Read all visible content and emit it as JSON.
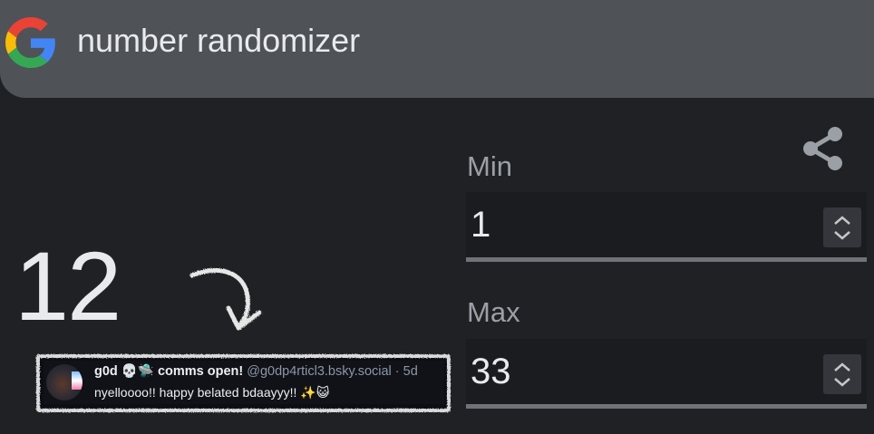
{
  "search": {
    "query": "number randomizer",
    "logo_icon": "google-g-logo"
  },
  "randomizer": {
    "result": "12",
    "share_icon": "share-icon",
    "min": {
      "label": "Min",
      "value": "1"
    },
    "max": {
      "label": "Max",
      "value": "33"
    }
  },
  "annotation": {
    "arrow_icon": "hand-drawn-arrow",
    "tweet": {
      "name": "g0d 💀🛸 comms open!",
      "handle": "@g0dp4rticl3.bsky.social · 5d",
      "text": "nyelloooo!! happy belated bdaayyy!! ✨😺"
    }
  },
  "colors": {
    "background": "#202124",
    "search_bar": "#4f5256",
    "field_bg": "#1b1c20",
    "field_underline": "#6f7276",
    "label": "#9aa0a6",
    "text": "#e8eaed",
    "google_blue": "#4285F4",
    "google_red": "#EA4335",
    "google_yellow": "#FBBC05",
    "google_green": "#34A853"
  }
}
